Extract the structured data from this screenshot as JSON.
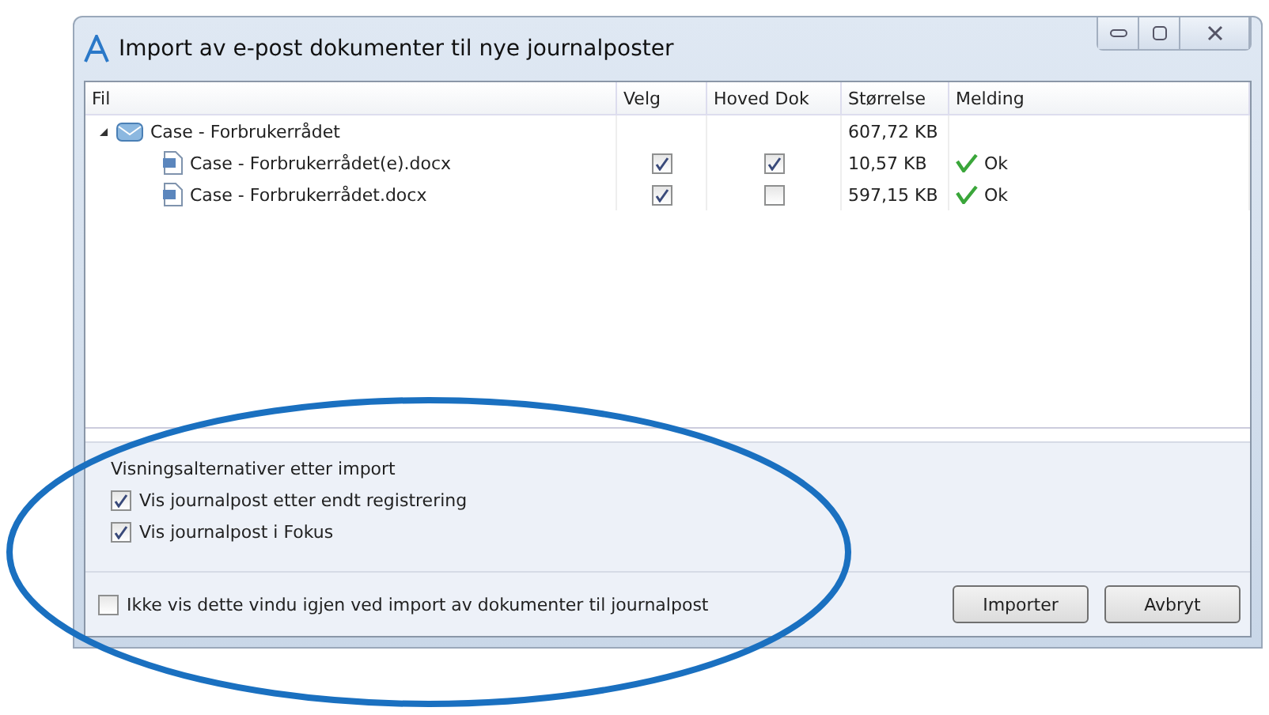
{
  "window": {
    "title": "Import av e-post dokumenter til nye journalposter"
  },
  "table": {
    "columns": [
      "Fil",
      "Velg",
      "Hoved Dok",
      "Størrelse",
      "Melding"
    ],
    "rows": [
      {
        "kind": "group",
        "name": "Case - Forbrukerrådet",
        "expanded": true,
        "size": "607,72 KB"
      },
      {
        "kind": "file",
        "name": "Case - Forbrukerrådet(e).docx",
        "select": true,
        "main": true,
        "size": "10,57 KB",
        "message": "Ok"
      },
      {
        "kind": "file",
        "name": "Case - Forbrukerrådet.docx",
        "select": true,
        "main": false,
        "size": "597,15 KB",
        "message": "Ok"
      }
    ]
  },
  "options": {
    "title": "Visningsalternativer etter import",
    "items": [
      {
        "label": "Vis journalpost etter endt registrering",
        "checked": true
      },
      {
        "label": "Vis journalpost i Fokus",
        "checked": true
      }
    ]
  },
  "footer": {
    "checkbox": {
      "label": "Ikke vis dette vindu igjen ved import av dokumenter til journalpost",
      "checked": false
    },
    "buttons": [
      "Importer",
      "Avbryt"
    ]
  }
}
